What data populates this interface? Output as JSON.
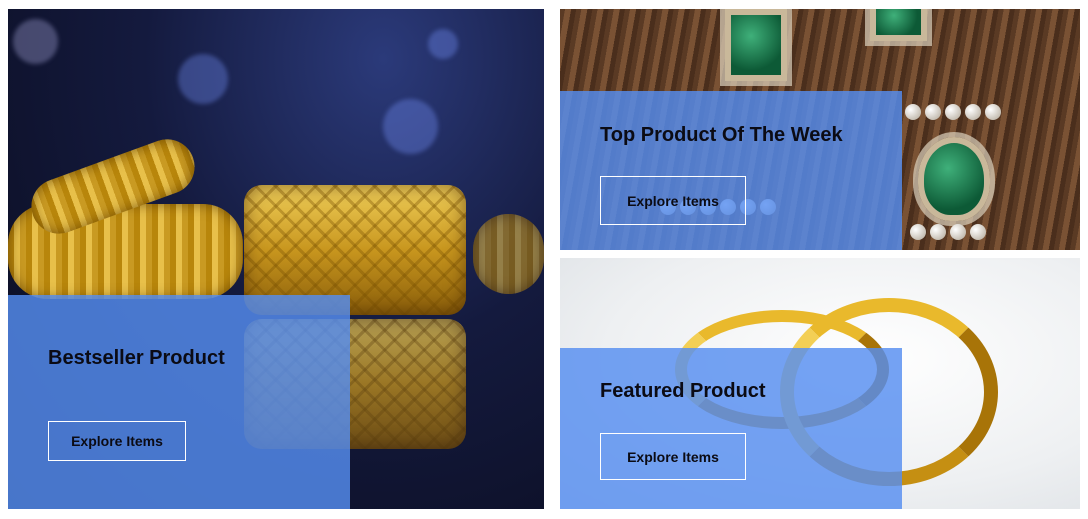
{
  "banners": [
    {
      "title": "Bestseller Product",
      "button_label": "Explore Items",
      "image": "gold-bangles-photo"
    },
    {
      "title": "Top Product Of The Week",
      "button_label": "Explore Items",
      "image": "emerald-jewelry-photo"
    },
    {
      "title": "Featured Product",
      "button_label": "Explore Items",
      "image": "gold-rings-photo"
    }
  ],
  "colors": {
    "panel_overlay": "#568df0",
    "title_text": "#0b0b14",
    "button_border": "#ffffff"
  }
}
